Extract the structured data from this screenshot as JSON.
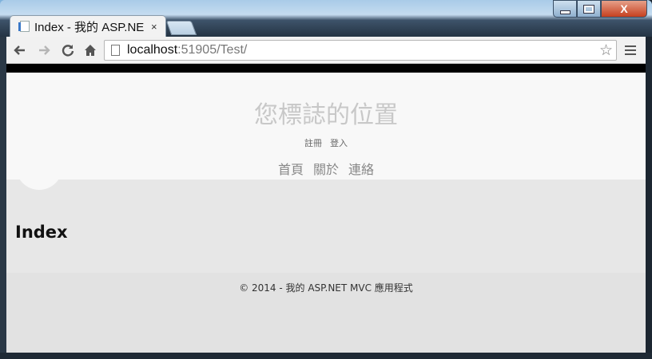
{
  "browser": {
    "tab_title": "Index - 我的 ASP.NE",
    "tab_close": "×",
    "window_buttons": {
      "close": "X"
    },
    "url_host": "localhost",
    "url_rest": ":51905/Test/",
    "icons": [
      "back-icon",
      "forward-icon",
      "reload-icon",
      "home-icon",
      "page-icon",
      "star-icon",
      "menu-icon"
    ]
  },
  "page": {
    "site_title": "您標誌的位置",
    "login_links": [
      "註冊",
      "登入"
    ],
    "nav": [
      "首頁",
      "關於",
      "連絡"
    ],
    "heading": "Index",
    "footer": "© 2014 - 我的 ASP.NET MVC 應用程式"
  }
}
